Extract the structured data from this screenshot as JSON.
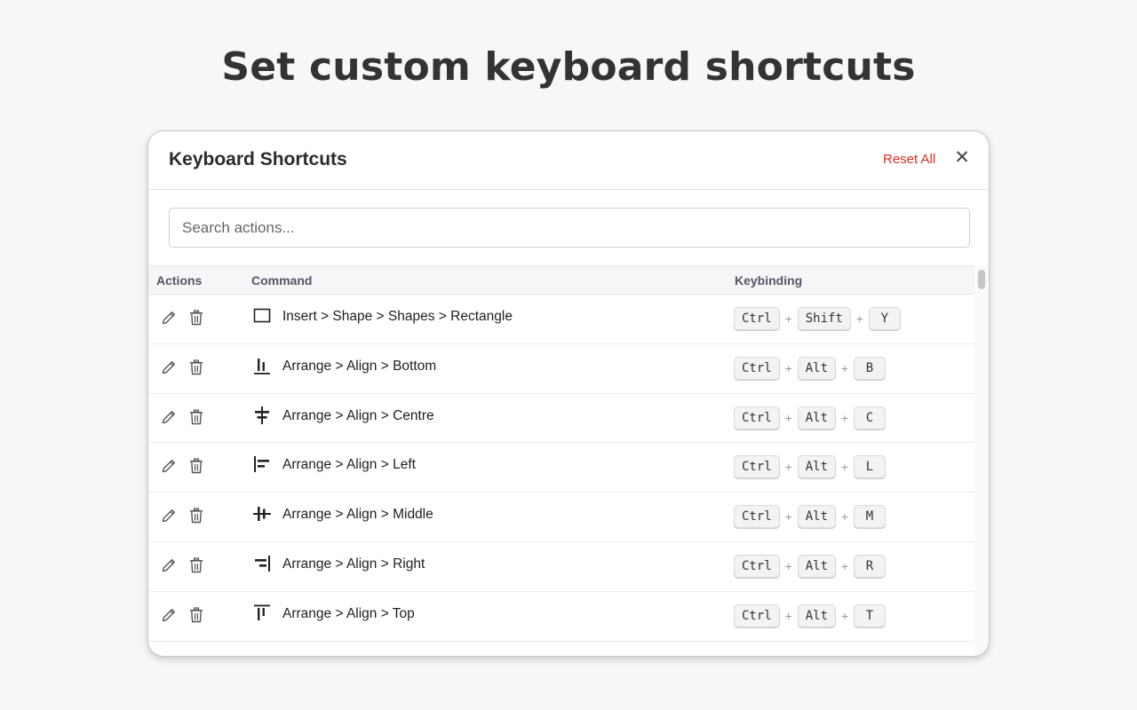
{
  "headline": "Set custom keyboard shortcuts",
  "dialog": {
    "title": "Keyboard Shortcuts",
    "reset_label": "Reset All",
    "close_label": "✕"
  },
  "search": {
    "placeholder": "Search actions..."
  },
  "columns": {
    "actions": "Actions",
    "command": "Command",
    "keybinding": "Keybinding"
  },
  "colors": {
    "reset": "#d93025",
    "headline": "#333333",
    "background": "#f7f7f7"
  },
  "rows": [
    {
      "icon": "rectangle-icon",
      "command": "Insert > Shape > Shapes > Rectangle",
      "keys": [
        "Ctrl",
        "Shift",
        "Y"
      ]
    },
    {
      "icon": "align-bottom-icon",
      "command": "Arrange > Align > Bottom",
      "keys": [
        "Ctrl",
        "Alt",
        "B"
      ]
    },
    {
      "icon": "align-centre-icon",
      "command": "Arrange > Align > Centre",
      "keys": [
        "Ctrl",
        "Alt",
        "C"
      ]
    },
    {
      "icon": "align-left-icon",
      "command": "Arrange > Align > Left",
      "keys": [
        "Ctrl",
        "Alt",
        "L"
      ]
    },
    {
      "icon": "align-middle-icon",
      "command": "Arrange > Align > Middle",
      "keys": [
        "Ctrl",
        "Alt",
        "M"
      ]
    },
    {
      "icon": "align-right-icon",
      "command": "Arrange > Align > Right",
      "keys": [
        "Ctrl",
        "Alt",
        "R"
      ]
    },
    {
      "icon": "align-top-icon",
      "command": "Arrange > Align > Top",
      "keys": [
        "Ctrl",
        "Alt",
        "T"
      ]
    }
  ]
}
